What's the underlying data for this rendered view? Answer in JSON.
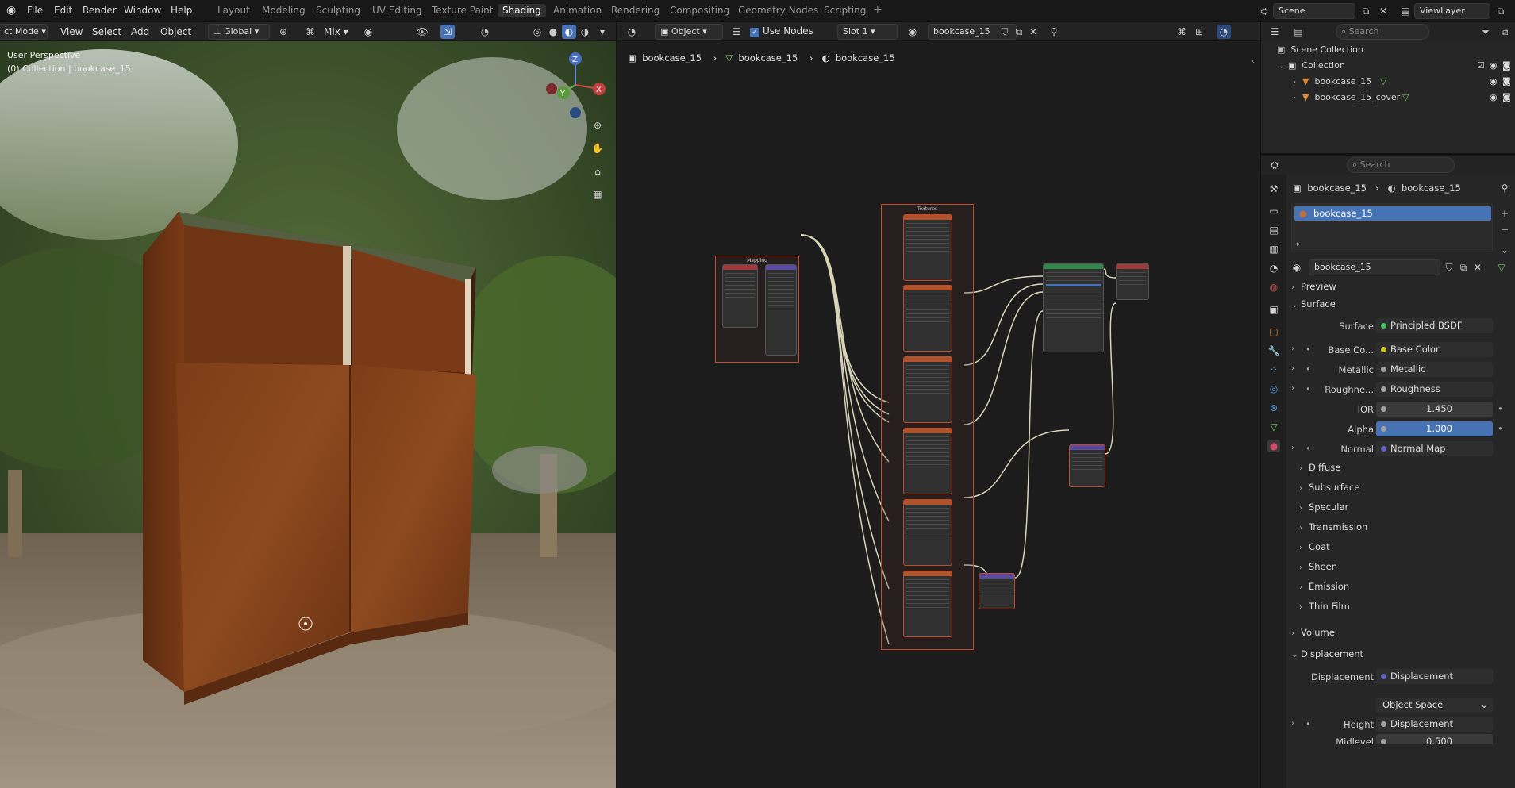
{
  "menu": {
    "file": "File",
    "edit": "Edit",
    "render": "Render",
    "window": "Window",
    "help": "Help"
  },
  "workspaces": [
    "Layout",
    "Modeling",
    "Sculpting",
    "UV Editing",
    "Texture Paint",
    "Shading",
    "Animation",
    "Rendering",
    "Compositing",
    "Geometry Nodes",
    "Scripting"
  ],
  "active_workspace": "Shading",
  "scene": {
    "name": "Scene",
    "viewlayer": "ViewLayer"
  },
  "viewport_header": {
    "mode": "ct Mode",
    "view": "View",
    "select": "Select",
    "add": "Add",
    "object": "Object",
    "orientation": "Global",
    "blend": "Mix"
  },
  "viewport": {
    "perspective": "User Perspective",
    "collection_info": "(0) Collection | bookcase_15"
  },
  "node_header": {
    "type": "Object",
    "use_nodes": "Use Nodes",
    "slot": "Slot 1",
    "material": "bookcase_15"
  },
  "breadcrumbs": [
    "bookcase_15",
    "bookcase_15",
    "bookcase_15"
  ],
  "node_frames": {
    "mapping": "Mapping",
    "textures": "Textures"
  },
  "outliner": {
    "search_placeholder": "Search",
    "scene_collection": "Scene Collection",
    "collection": "Collection",
    "items": [
      "bookcase_15",
      "bookcase_15_cover"
    ]
  },
  "properties": {
    "search_placeholder": "Search",
    "breadcrumb_obj": "bookcase_15",
    "breadcrumb_mat": "bookcase_15",
    "material_slot": "bookcase_15",
    "material_name": "bookcase_15",
    "preview": "Preview",
    "surface_panel": "Surface",
    "rows": [
      {
        "label": "Surface",
        "value": "Principled BSDF",
        "dot": "#3fbf5f"
      },
      {
        "label": "Base Co...",
        "value": "Base Color",
        "dot": "#c7c729"
      },
      {
        "label": "Metallic",
        "value": "Metallic",
        "dot": "#a1a1a1"
      },
      {
        "label": "Roughne...",
        "value": "Roughness",
        "dot": "#a1a1a1"
      },
      {
        "label": "IOR",
        "value": "1.450",
        "dot": "#a1a1a1"
      },
      {
        "label": "Alpha",
        "value": "1.000",
        "dot": "#a1a1a1"
      },
      {
        "label": "Normal",
        "value": "Normal Map",
        "dot": "#6363c7"
      }
    ],
    "subpanels": [
      "Diffuse",
      "Subsurface",
      "Specular",
      "Transmission",
      "Coat",
      "Sheen",
      "Emission",
      "Thin Film"
    ],
    "volume": "Volume",
    "displacement_panel": "Displacement",
    "displacement_row": {
      "label": "Displacement",
      "value": "Displacement",
      "dot": "#6363c7"
    },
    "space": "Object Space",
    "height_row": {
      "label": "Height",
      "value": "Displacement",
      "dot": "#a1a1a1"
    },
    "midlevel_row": {
      "label": "Midlevel",
      "value": "0.500"
    }
  },
  "colors": {
    "accent": "#4772b3",
    "frame": "#c44a2a",
    "wire": "#d8d4b8"
  }
}
